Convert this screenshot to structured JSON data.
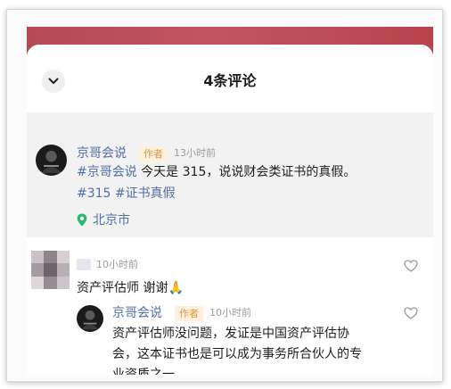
{
  "header": {
    "title": "4条评论"
  },
  "pinned_post": {
    "author": "京哥会说",
    "author_tag": "作者",
    "time": "13小时前",
    "hashtag_1": "#京哥会说",
    "text_1": " 今天是 315，说说财会类证书的真假。",
    "hashtag_2": "#315",
    "hashtag_3": "#证书真假",
    "location": "北京市",
    "icons": {
      "location": "location-pin-icon",
      "collapse": "chevron-down-icon"
    }
  },
  "comment_1": {
    "time": "10小时前",
    "text": "资产评估师 谢谢🙏",
    "reply": {
      "author": "京哥会说",
      "author_tag": "作者",
      "time": "10小时前",
      "line_1": "资产评估师没问题，发证是中国资产评估协",
      "line_2": "会，这本证书也是可以成为事务所合伙人的专",
      "line_3": "业资质之一。"
    }
  },
  "colors": {
    "link": "#4f6fa6",
    "author_tag_text": "#e09a3f",
    "author_tag_bg": "#fdf0dc",
    "location_green": "#2bb673",
    "backdrop": "#b44a52"
  }
}
